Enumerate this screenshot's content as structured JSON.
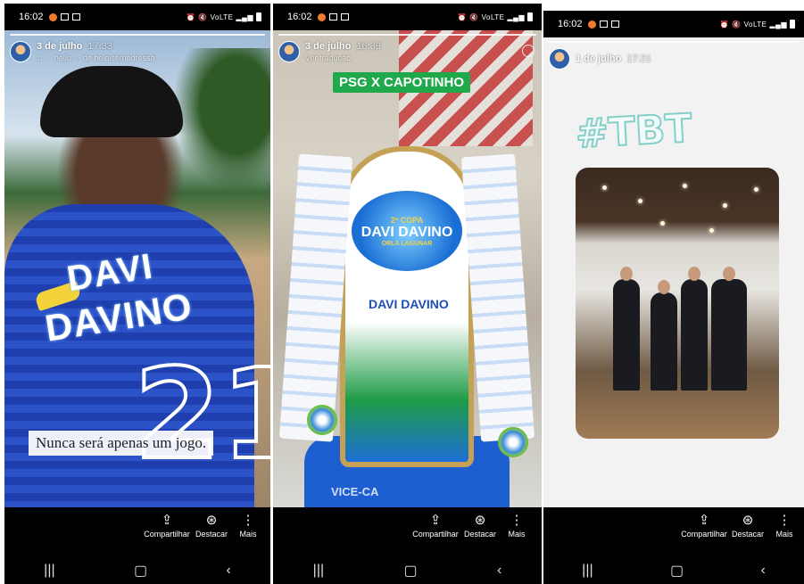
{
  "status_bar": {
    "time": "16:02",
    "signal_text": "VoLTE"
  },
  "stories": [
    {
      "date": "3 de julho",
      "time": "17:33",
      "subtitle": "♫ ♡ hello ♡ de heloisemedressa",
      "caption": "Nunca será apenas um jogo.",
      "shirt_line1": "DAVI",
      "shirt_line2": "DAVINO",
      "shirt_number": "21"
    },
    {
      "date": "3 de julho",
      "time": "16:39",
      "subtitle": "Ver tradução",
      "title_sticker": "PSG X CAPOTINHO",
      "logo_top": "2ª COPA",
      "logo_mid": "DAVI DAVINO",
      "logo_bottom": "ORLA LAGUNAR",
      "brand_mark": "DAVI DAVINO",
      "base_text": "VICE-CA"
    },
    {
      "date": "1 de julho",
      "time": "17:21",
      "hashtag": "#TBT"
    }
  ],
  "actions": {
    "share": "Compartilhar",
    "highlight": "Destacar",
    "more": "Mais"
  },
  "icons": {
    "share": "share-icon",
    "highlight": "heart-circle-icon",
    "more": "more-vertical-icon",
    "nav_recent": "recent-apps-icon",
    "nav_home": "home-icon",
    "nav_back": "back-icon"
  }
}
